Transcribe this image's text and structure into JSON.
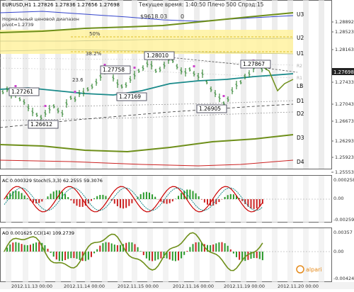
{
  "header": {
    "symbol_line": "EURUSD,H1  1.27826 1.27836 1.27656 1.27698",
    "indicator_name": "Нормальный ценовой диапазон",
    "pivot": "pivot=1.2739",
    "balance": "$9618.03",
    "zero": "0",
    "server_time": "Текущее время: 1:40:50 Плечо 500 Спрэд:15"
  },
  "fibo": {
    "level_50": "50%",
    "level_38": "38.2%"
  },
  "level_labels": {
    "u3": "U3",
    "u2": "U2",
    "u1": "U1",
    "lb": "LB",
    "d1": "D1",
    "d2": "D2",
    "d3": "D3",
    "d4": "D4",
    "r2": "R2",
    "r1": "R1"
  },
  "price_labels": [
    "1.27261",
    "1.27758",
    "1.28010",
    "1.27169",
    "1.26612",
    "1.26905",
    "1.27867"
  ],
  "misc_labels": {
    "val_23_6": "23.6"
  },
  "price_axis": {
    "ticks": [
      "1.28892",
      "1.28523",
      "1.28163",
      "1.27698",
      "1.27433",
      "1.27043",
      "1.26673",
      "1.26293",
      "1.25923",
      "1.25553"
    ],
    "current": "1.27698"
  },
  "time_axis": {
    "labels": [
      "2012.11.13 00:00",
      "2012.11.14 00:00",
      "2012.11.15 00:00",
      "2012.11.16 00:00",
      "2012.11.19 00:00",
      "2012.11.20 00:00"
    ]
  },
  "stoch_panel": {
    "title": "AC 0.000329  Stoch(5,3,3) 62.2555 59.3076",
    "axis_top": "0.000258",
    "axis_mid": "0.00",
    "axis_bottom": "-0.00259"
  },
  "cci_panel": {
    "title": "AO 0.001625  CCI(14) 109.2739",
    "axis_top": "0.00357",
    "axis_mid": "0.00",
    "axis_bottom": "-0.00424"
  },
  "watermark": "alpari",
  "colors": {
    "price_bg": "#ffffff",
    "fibo_band": "#fff2a0",
    "green_channel": "#6e8f1a",
    "teal_ma": "#1a8a8a",
    "price_bars": "#1f7a1f",
    "red_line": "#cc2222",
    "blue_line": "#3344cc"
  }
}
